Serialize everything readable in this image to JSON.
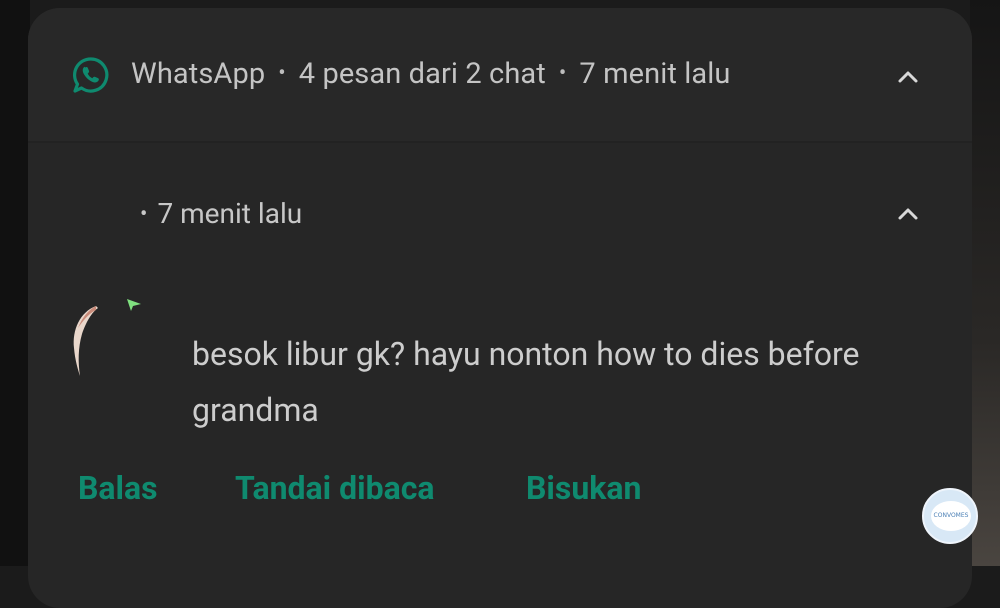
{
  "notification": {
    "app_name": "WhatsApp",
    "summary": "4 pesan dari 2 chat",
    "time": "7 menit lalu",
    "separator": "•"
  },
  "conversation": {
    "sender": "",
    "time": "7 menit lalu",
    "separator": "•",
    "message": "besok libur gk? hayu nonton how to dies before grandma"
  },
  "actions": {
    "reply": "Balas",
    "mark_read": "Tandai dibaca",
    "mute": "Bisukan"
  },
  "floating_button": {
    "label": "CONVOMES"
  },
  "colors": {
    "accent": "#0f8a6f",
    "card": "#262626",
    "text": "#cdcdcd"
  }
}
